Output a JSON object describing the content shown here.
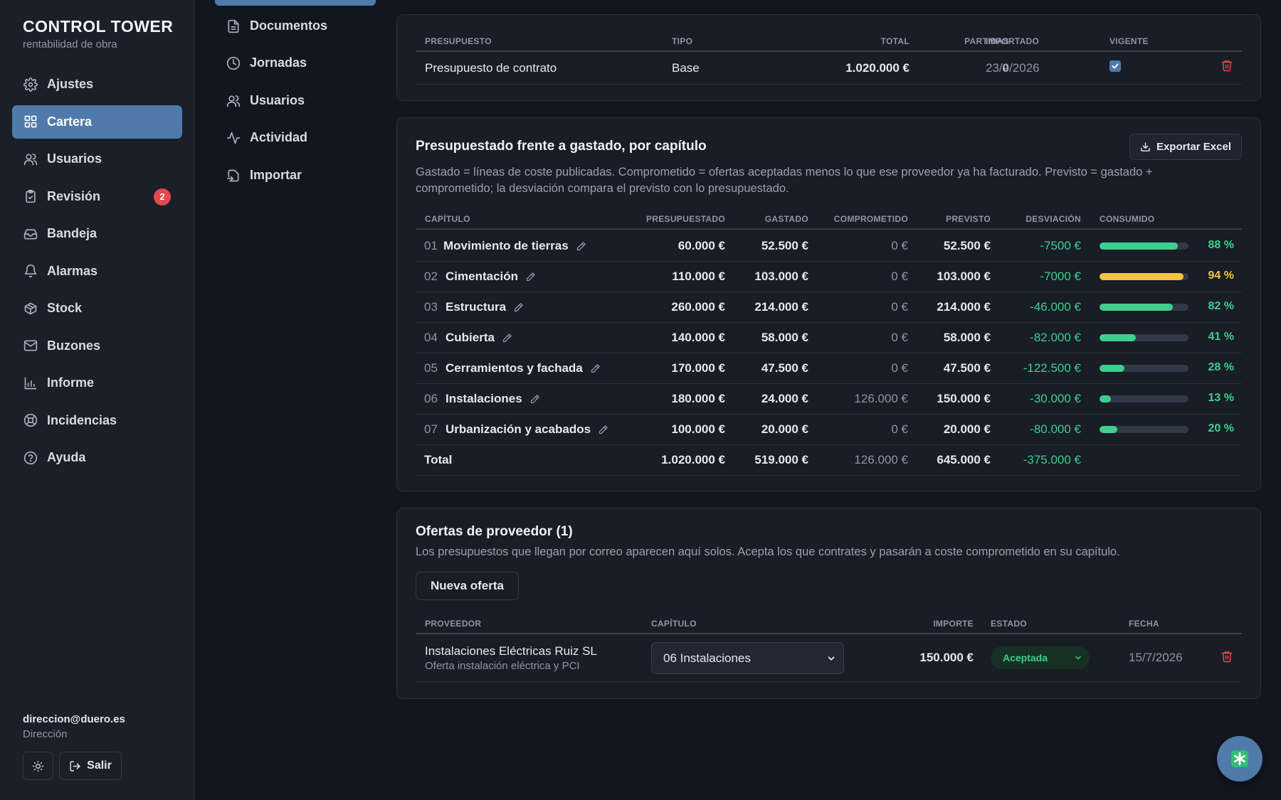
{
  "brand": {
    "title": "CONTROL TOWER",
    "subtitle": "rentabilidad de obra"
  },
  "sidebar": {
    "items": [
      {
        "label": "Ajustes",
        "icon": "gear-icon",
        "active": false
      },
      {
        "label": "Cartera",
        "icon": "grid-icon",
        "active": true
      },
      {
        "label": "Usuarios",
        "icon": "users-icon",
        "active": false
      },
      {
        "label": "Revisión",
        "icon": "clipboard-check-icon",
        "active": false,
        "badge": "2"
      },
      {
        "label": "Bandeja",
        "icon": "inbox-icon",
        "active": false
      },
      {
        "label": "Alarmas",
        "icon": "bell-icon",
        "active": false
      },
      {
        "label": "Stock",
        "icon": "package-icon",
        "active": false
      },
      {
        "label": "Buzones",
        "icon": "mail-icon",
        "active": false
      },
      {
        "label": "Informe",
        "icon": "bar-chart-icon",
        "active": false
      },
      {
        "label": "Incidencias",
        "icon": "lifebuoy-icon",
        "active": false
      },
      {
        "label": "Ayuda",
        "icon": "help-circle-icon",
        "active": false
      }
    ],
    "user": {
      "email": "direccion@duero.es",
      "role": "Dirección"
    },
    "logout_label": "Salir"
  },
  "subnav": {
    "items": [
      {
        "label": "Documentos",
        "icon": "file-text-icon"
      },
      {
        "label": "Jornadas",
        "icon": "clock-icon"
      },
      {
        "label": "Usuarios",
        "icon": "users-icon"
      },
      {
        "label": "Actividad",
        "icon": "activity-icon"
      },
      {
        "label": "Importar",
        "icon": "import-icon"
      }
    ]
  },
  "budget": {
    "headers": {
      "name": "PRESUPUESTO",
      "type": "TIPO",
      "total": "TOTAL",
      "lines": "PARTIDAS",
      "imported": "IMPORTADO",
      "current": "VIGENTE"
    },
    "row": {
      "name": "Presupuesto de contrato",
      "type": "Base",
      "total": "1.020.000 €",
      "lines": "0",
      "imported": "23/9/2026",
      "current": true
    }
  },
  "chapters": {
    "title": "Presupuestado frente a gastado, por capítulo",
    "description_line1": "Gastado = líneas de coste publicadas. Comprometido = ofertas aceptadas menos lo que ese proveedor ya ha facturado. Previsto = gastado +",
    "description_line2": "comprometido; la desviación compara el previsto con lo presupuestado.",
    "export_label": "Exportar Excel",
    "headers": {
      "chapter": "CAPÍTULO",
      "budgeted": "PRESUPUESTADO",
      "spent": "GASTADO",
      "committed": "COMPROMETIDO",
      "forecast": "PREVISTO",
      "deviation": "DESVIACIÓN",
      "consumed": "CONSUMIDO"
    },
    "rows": [
      {
        "num": "01",
        "name": "Movimiento de tierras",
        "budgeted": "60.000 €",
        "spent": "52.500 €",
        "committed": "0 €",
        "forecast": "52.500 €",
        "deviation": "-7500 €",
        "consumed": 0.88,
        "consumed_label": "88 %",
        "color": "#3ecf8e"
      },
      {
        "num": "02",
        "name": "Cimentación",
        "budgeted": "110.000 €",
        "spent": "103.000 €",
        "committed": "0 €",
        "forecast": "103.000 €",
        "deviation": "-7000 €",
        "consumed": 0.94,
        "consumed_label": "94 %",
        "color": "#f5c542"
      },
      {
        "num": "03",
        "name": "Estructura",
        "budgeted": "260.000 €",
        "spent": "214.000 €",
        "committed": "0 €",
        "forecast": "214.000 €",
        "deviation": "-46.000 €",
        "consumed": 0.82,
        "consumed_label": "82 %",
        "color": "#3ecf8e"
      },
      {
        "num": "04",
        "name": "Cubierta",
        "budgeted": "140.000 €",
        "spent": "58.000 €",
        "committed": "0 €",
        "forecast": "58.000 €",
        "deviation": "-82.000 €",
        "consumed": 0.41,
        "consumed_label": "41 %",
        "color": "#3ecf8e"
      },
      {
        "num": "05",
        "name": "Cerramientos y fachada",
        "budgeted": "170.000 €",
        "spent": "47.500 €",
        "committed": "0 €",
        "forecast": "47.500 €",
        "deviation": "-122.500 €",
        "consumed": 0.28,
        "consumed_label": "28 %",
        "color": "#3ecf8e"
      },
      {
        "num": "06",
        "name": "Instalaciones",
        "budgeted": "180.000 €",
        "spent": "24.000 €",
        "committed": "126.000 €",
        "forecast": "150.000 €",
        "deviation": "-30.000 €",
        "consumed": 0.13,
        "consumed_label": "13 %",
        "color": "#3ecf8e"
      },
      {
        "num": "07",
        "name": "Urbanización y acabados",
        "budgeted": "100.000 €",
        "spent": "20.000 €",
        "committed": "0 €",
        "forecast": "20.000 €",
        "deviation": "-80.000 €",
        "consumed": 0.2,
        "consumed_label": "20 %",
        "color": "#3ecf8e"
      }
    ],
    "total": {
      "label": "Total",
      "budgeted": "1.020.000 €",
      "spent": "519.000 €",
      "committed": "126.000 €",
      "forecast": "645.000 €",
      "deviation": "-375.000 €"
    }
  },
  "offers": {
    "title": "Ofertas de proveedor (1)",
    "description": "Los presupuestos que llegan por correo aparecen aquí solos. Acepta los que contrates y pasarán a coste comprometido en su capítulo.",
    "new_label": "Nueva oferta",
    "headers": {
      "supplier": "PROVEEDOR",
      "chapter": "CAPÍTULO",
      "amount": "IMPORTE",
      "status": "ESTADO",
      "date": "FECHA"
    },
    "row": {
      "supplier": "Instalaciones Eléctricas Ruiz SL",
      "subtitle": "Oferta instalación eléctrica y PCI",
      "chapter": "06 Instalaciones",
      "amount": "150.000 €",
      "status": "Aceptada",
      "date": "15/7/2026"
    }
  },
  "colors": {
    "accent": "#4f7aaa",
    "positive": "#3ecf8e",
    "warning": "#f5c542",
    "danger": "#e5484d"
  }
}
